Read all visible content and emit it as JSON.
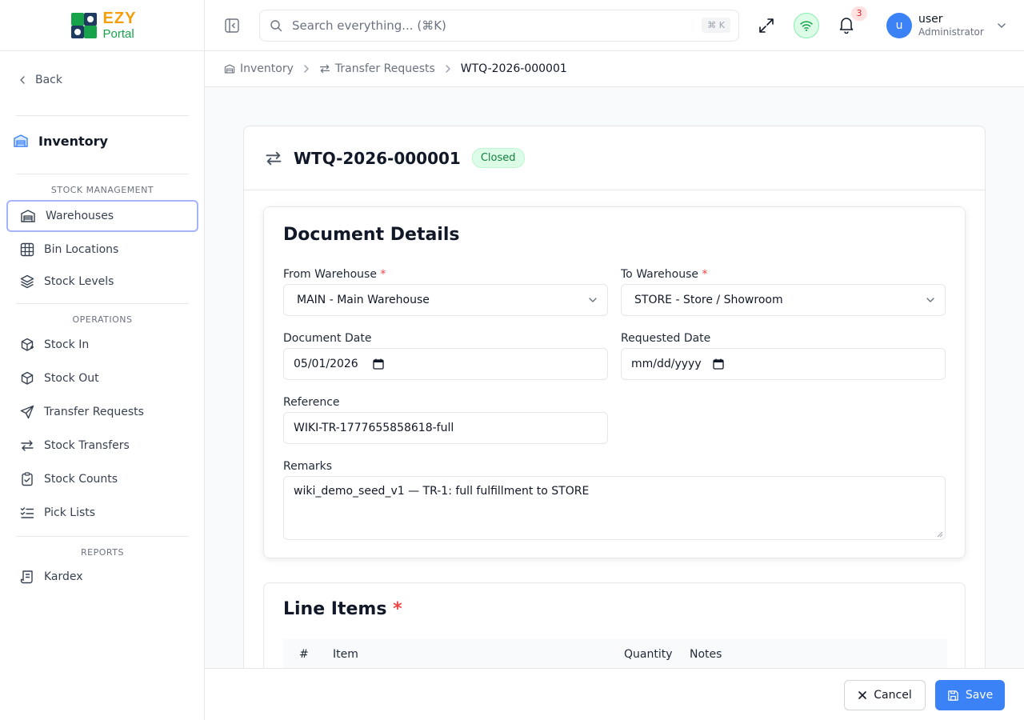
{
  "app": {
    "logo_line1": "EZY",
    "logo_line2": "Portal"
  },
  "sidebar": {
    "back_label": "Back",
    "module_title": "Inventory",
    "sections": [
      {
        "label": "STOCK MANAGEMENT"
      },
      {
        "label": "OPERATIONS"
      },
      {
        "label": "REPORTS"
      }
    ],
    "items": [
      {
        "label": "Warehouses",
        "icon": "warehouse-icon",
        "active": true
      },
      {
        "label": "Bin Locations",
        "icon": "grid-icon"
      },
      {
        "label": "Stock Levels",
        "icon": "layers-icon"
      },
      {
        "label": "Stock In",
        "icon": "package-plus-icon"
      },
      {
        "label": "Stock Out",
        "icon": "package-minus-icon"
      },
      {
        "label": "Transfer Requests",
        "icon": "send-icon"
      },
      {
        "label": "Stock Transfers",
        "icon": "arrows-left-right-icon"
      },
      {
        "label": "Stock Counts",
        "icon": "clipboard-check-icon"
      },
      {
        "label": "Pick Lists",
        "icon": "list-checks-icon"
      },
      {
        "label": "Kardex",
        "icon": "scroll-icon"
      }
    ]
  },
  "topbar": {
    "search_placeholder": "Search everything... (⌘K)",
    "search_shortcut": "⌘ K",
    "notification_count": "3",
    "user_name": "user",
    "user_role": "Administrator",
    "avatar_initial": "u"
  },
  "breadcrumb": [
    {
      "label": "Inventory"
    },
    {
      "label": "Transfer Requests"
    },
    {
      "label": "WTQ-2026-000001"
    }
  ],
  "document": {
    "number": "WTQ-2026-000001",
    "status": "Closed",
    "colors": {
      "status_bg": "#dcfce7",
      "status_text": "#15803d",
      "accent": "#3b82f6"
    }
  },
  "details": {
    "title": "Document Details",
    "from_warehouse_label": "From Warehouse",
    "from_warehouse_value": "MAIN - Main Warehouse",
    "to_warehouse_label": "To Warehouse",
    "to_warehouse_value": "STORE - Store / Showroom",
    "document_date_label": "Document Date",
    "document_date_value": "05/01/2026",
    "requested_date_label": "Requested Date",
    "requested_date_value": "mm/dd/yyyy",
    "reference_label": "Reference",
    "reference_value": "WIKI-TR-1777655858618-full",
    "remarks_label": "Remarks",
    "remarks_value": "wiki_demo_seed_v1 — TR-1: full fulfillment to STORE",
    "required_marker": "*"
  },
  "line_items": {
    "title": "Line Items",
    "columns": [
      "#",
      "Item",
      "Quantity",
      "Notes"
    ]
  },
  "footer": {
    "cancel_label": "Cancel",
    "save_label": "Save"
  }
}
